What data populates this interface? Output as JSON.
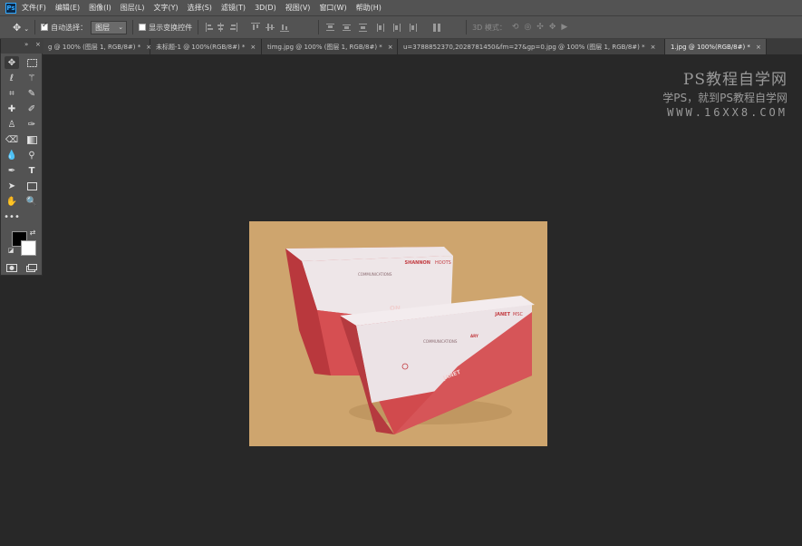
{
  "app": {
    "logo_text": "Ps"
  },
  "menu": [
    "文件(F)",
    "编辑(E)",
    "图像(I)",
    "图层(L)",
    "文字(Y)",
    "选择(S)",
    "滤镜(T)",
    "3D(D)",
    "视图(V)",
    "窗口(W)",
    "帮助(H)"
  ],
  "options": {
    "auto_select_label": "自动选择：",
    "auto_select_checked": true,
    "layer_select_value": "图层",
    "show_transform_label": "显示变换控件",
    "show_transform_checked": false,
    "mode_3d_label": "3D 模式："
  },
  "tabs": [
    {
      "label": "g @ 100% (图层 1, RGB/8#) *",
      "close": "×",
      "active": false
    },
    {
      "label": "未标题-1 @ 100%(RGB/8#) *",
      "close": "×",
      "active": false
    },
    {
      "label": "timg.jpg @ 100% (图层 1, RGB/8#) *",
      "close": "×",
      "active": false
    },
    {
      "label": "u=3788852370,2028781450&fm=27&gp=0.jpg @ 100% (图层 1, RGB/8#) *",
      "close": "×",
      "active": false
    },
    {
      "label": "1.jpg @ 100%(RGB/8#) *",
      "close": "×",
      "active": true
    }
  ],
  "toolbox": {
    "collapse_label": "»",
    "close_label": "×"
  },
  "canvas": {
    "background_color": "#cea56e",
    "box_red": "#d14a4d",
    "box_white": "#eee6e8"
  },
  "box_print": {
    "back_brand": "SHANNON",
    "back_brand_tail": "HOOTS",
    "back_sub": "COMMUNICATIONS",
    "back_mid": "ON",
    "front_brand": "JANET",
    "front_brand_tail": "MSC",
    "front_sub": "COMMUNICATIONS",
    "front_sub_bold": "ARY",
    "front_spine": "JANET"
  },
  "watermark": {
    "line1": "PS教程自学网",
    "line2": "学PS，就到PS教程自学网",
    "line3": "WWW.16XX8.COM"
  }
}
